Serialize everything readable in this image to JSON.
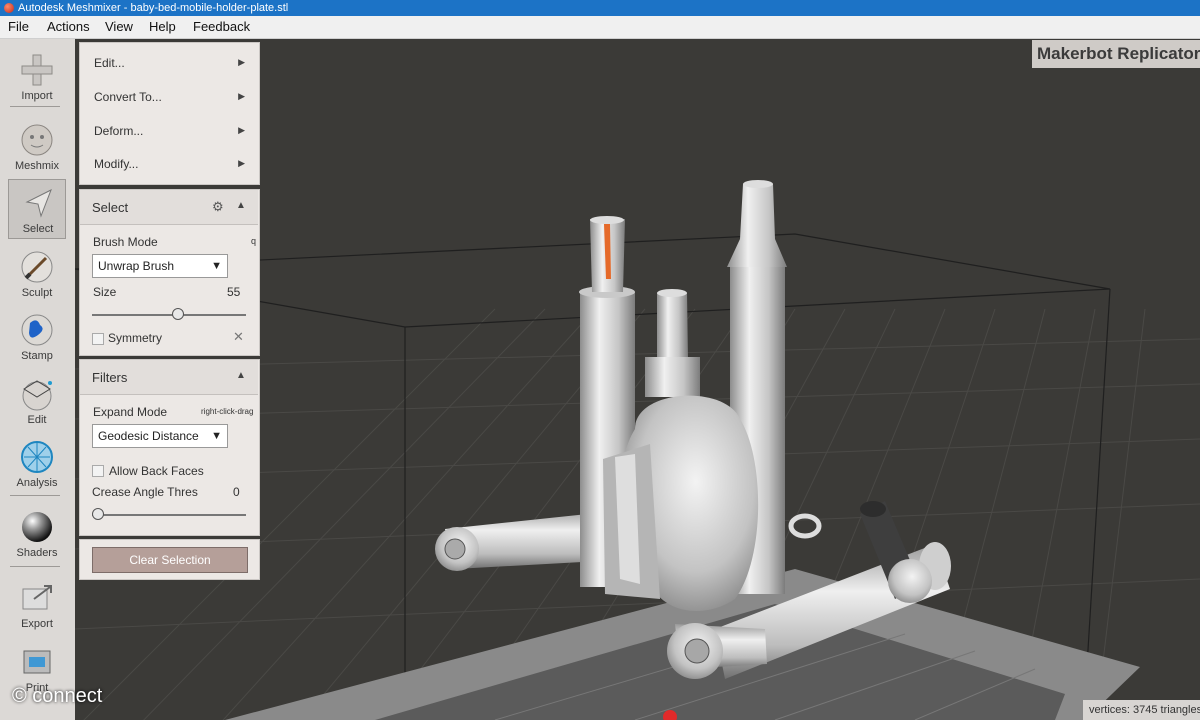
{
  "window": {
    "title": "Autodesk Meshmixer - baby-bed-mobile-holder-plate.stl"
  },
  "menubar": {
    "items": [
      "File",
      "Actions",
      "View",
      "Help",
      "Feedback"
    ]
  },
  "toolbar": {
    "tools": [
      {
        "label": "Import",
        "icon": "import-icon"
      },
      {
        "label": "Meshmix",
        "icon": "meshmix-icon"
      },
      {
        "label": "Select",
        "icon": "select-icon",
        "active": true
      },
      {
        "label": "Sculpt",
        "icon": "sculpt-icon"
      },
      {
        "label": "Stamp",
        "icon": "stamp-icon"
      },
      {
        "label": "Edit",
        "icon": "edit-icon"
      },
      {
        "label": "Analysis",
        "icon": "analysis-icon"
      },
      {
        "label": "Shaders",
        "icon": "shaders-icon"
      },
      {
        "label": "Export",
        "icon": "export-icon"
      },
      {
        "label": "Print",
        "icon": "print-icon"
      }
    ]
  },
  "select_menu": {
    "items": [
      "Edit...",
      "Convert To...",
      "Deform...",
      "Modify..."
    ]
  },
  "select_panel": {
    "title": "Select",
    "brush_mode_label": "Brush Mode",
    "brush_mode_hotkey": "q",
    "brush_mode_value": "Unwrap Brush",
    "size_label": "Size",
    "size_value": "55",
    "size_fraction": 0.55,
    "symmetry_label": "Symmetry"
  },
  "filters_panel": {
    "title": "Filters",
    "expand_mode_label": "Expand Mode",
    "expand_mode_hint": "right-click-drag",
    "expand_mode_value": "Geodesic Distance",
    "allow_back_faces_label": "Allow Back Faces",
    "crease_angle_label": "Crease Angle Thres",
    "crease_angle_value": "0",
    "crease_fraction": 0
  },
  "clear_selection_label": "Clear Selection",
  "viewport": {
    "printer_name": "Makerbot Replicator",
    "status": "vertices: 3745 triangles"
  },
  "watermark": "© connect",
  "colors": {
    "titlebar": "#1c73c6",
    "viewport_bg": "#3b3a37",
    "bed": "#8a8a8a",
    "selection": "#e56a2a",
    "button": "#b59f99"
  }
}
